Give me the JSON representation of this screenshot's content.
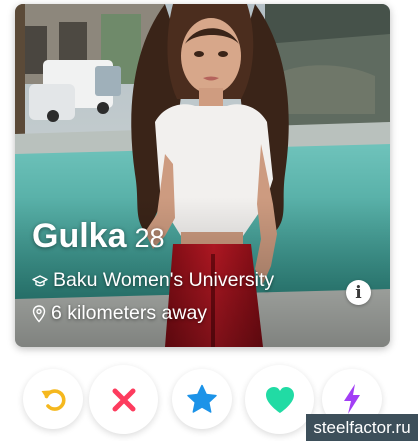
{
  "profile": {
    "name": "Gulka",
    "age": "28",
    "school": "Baku Women's University",
    "distance": "6 kilometers away",
    "info_icon": "i",
    "photo": "woman-in-white-top-red-pants-by-fountain"
  },
  "actions": [
    {
      "name": "rewind",
      "icon": "rewind-icon",
      "color": "#f5b81e"
    },
    {
      "name": "nope",
      "icon": "x-icon",
      "color": "#fd3c5e"
    },
    {
      "name": "super-like",
      "icon": "star-icon",
      "color": "#1c93e8"
    },
    {
      "name": "like",
      "icon": "heart-icon",
      "color": "#21dba4"
    },
    {
      "name": "boost",
      "icon": "lightning-icon",
      "color": "#a23ef5"
    }
  ],
  "watermark": "steelfactor.ru"
}
